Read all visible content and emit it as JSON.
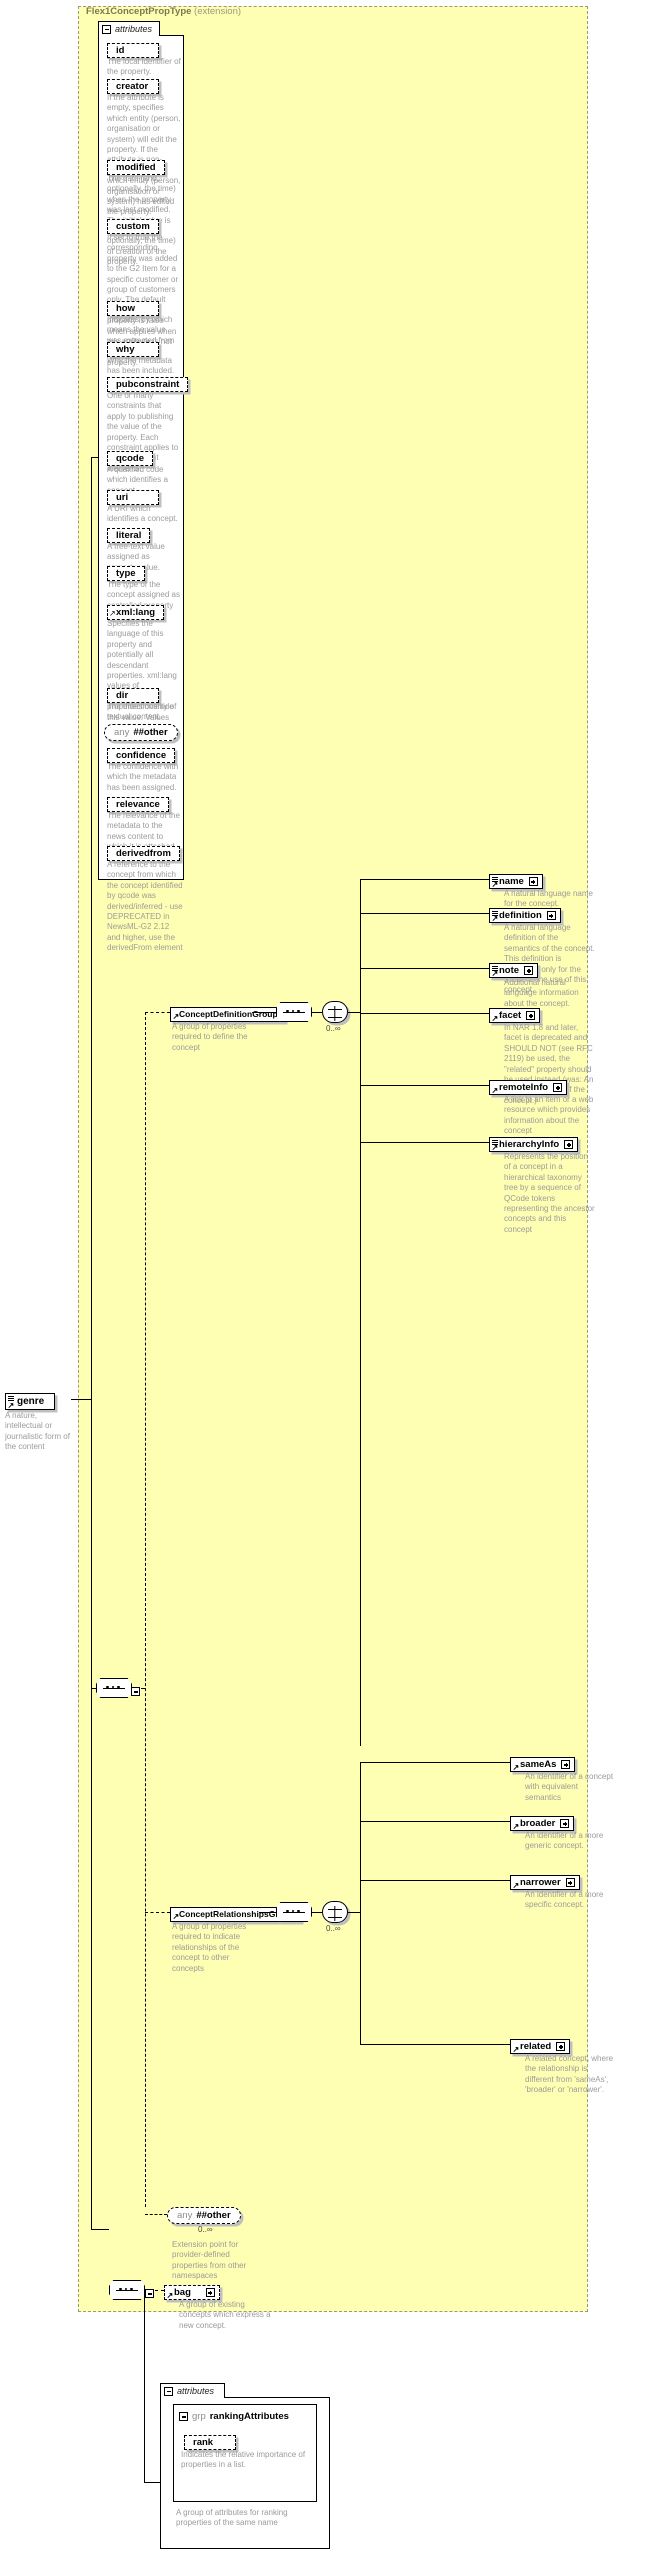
{
  "diagram": {
    "type": "xsd-schema-diagram",
    "root_element": {
      "name": "genre",
      "description": "A nature, intellectual or journalistic form of the content"
    },
    "extension_panel": {
      "title": "Flex1ConceptPropType",
      "subtitle": "(extension)"
    },
    "attributes_label": "attributes",
    "attributes": [
      {
        "name": "id",
        "description": "The local identifier of the property."
      },
      {
        "name": "creator",
        "description": "If the attribute is empty, specifies which entity (person, organisation or system) will edit the property. If the attribute is non-empty, specifies which entity (person, organisation or system) has edited the property."
      },
      {
        "name": "modified",
        "description": "The date (and, optionally, the time) when the property was last modified. The initial value is the date (and, optionally, the time) of creation of the property."
      },
      {
        "name": "custom",
        "description": "If set to true the corresponding property was added to the G2 Item for a specific customer or group of customers only. The default value of this property is false which applies when this attribute is not used with the property."
      },
      {
        "name": "how",
        "description": "Indicates by which means the value was extracted from the content."
      },
      {
        "name": "why",
        "description": "Why the metadata has been included."
      },
      {
        "name": "pubconstraint",
        "description": "One or many constraints that apply to publishing the value of the property. Each constraint applies to all descendant elements."
      },
      {
        "name": "qcode",
        "description": "A qualified code which identifies a concept."
      },
      {
        "name": "uri",
        "description": "A URI which identifies a concept."
      },
      {
        "name": "literal",
        "description": "A free-text value assigned as property value."
      },
      {
        "name": "type",
        "description": "The type of the concept assigned as controlled property value."
      },
      {
        "name": "xml:lang",
        "description": "Specifies the language of this property and potentially all descendant properties. xml:lang values of descendant properties override this value. Values are determined by Internet BCP 47."
      },
      {
        "name": "dir",
        "description": "The directionality of textual content."
      },
      {
        "name": "confidence",
        "description": "The confidence with which the metadata has been assigned."
      },
      {
        "name": "relevance",
        "description": "The relevance of the metadata to the news content to which it is attached."
      },
      {
        "name": "derivedfrom",
        "description": "A reference to the concept from which the concept identified by qcode was derived/inferred - use DEPRECATED in NewsML-G2 2.12 and higher, use the derivedFrom element"
      }
    ],
    "attribute_any": {
      "label_any": "any",
      "label_other": "##other"
    },
    "groups": [
      {
        "id": "concept-definition-group",
        "name": "ConceptDefinitionGroup",
        "description": "A group of properties required to define the concept",
        "cardinality": "0..∞",
        "elements": [
          {
            "name": "name",
            "description": "A natural language name for the concept."
          },
          {
            "name": "definition",
            "description": "A natural language definition of the semantics of the concept. This definition is normative only for the scope of the use of this concept."
          },
          {
            "name": "note",
            "description": "Additional natural language information about the concept."
          },
          {
            "name": "facet",
            "description": "In NAR 1.8 and later, facet is deprecated and SHOULD NOT (see RFC 2119) be used, the \"related\" property should be used instead (was: An intrinsic property of the concept.)"
          },
          {
            "name": "remoteInfo",
            "description": "A link to an item or a web resource which provides information about the concept"
          },
          {
            "name": "hierarchyInfo",
            "description": "Represents the position of a concept in a hierarchical taxonomy tree by a sequence of QCode tokens representing the ancestor concepts and this concept"
          }
        ]
      },
      {
        "id": "concept-relationships-group",
        "name": "ConceptRelationshipsGroup",
        "description": "A group of properties required to indicate relationships of the concept to other concepts",
        "cardinality": "0..∞",
        "elements": [
          {
            "name": "sameAs",
            "description": "An identifier of a concept with equivalent semantics"
          },
          {
            "name": "broader",
            "description": "An identifier of a more generic concept."
          },
          {
            "name": "narrower",
            "description": "An identifier of a more specific concept."
          },
          {
            "name": "related",
            "description": "A related concept, where the relationship is different from 'sameAs', 'broader' or 'narrower'."
          }
        ]
      }
    ],
    "extension_any": {
      "label_any": "any",
      "label_other": "##other",
      "cardinality": "0..∞",
      "description": "Extension point for provider-defined properties from other namespaces"
    },
    "bag": {
      "name": "bag",
      "description": "A group of existing concepts which express a new concept."
    },
    "ranking": {
      "attributes_label": "attributes",
      "grp_prefix": "grp",
      "group_name": "rankingAttributes",
      "attribute": {
        "name": "rank",
        "description": "Indicates the relative importance of properties in a list."
      },
      "group_description": "A group of attributes for ranking properties of the same name"
    },
    "colors": {
      "panel_fill": "#ffffb3",
      "panel_border": "#9a9a7a",
      "title_text": "#7a7a50",
      "description_text": "#9b9b9b",
      "node_shadow": "#bfbfbf",
      "line": "#000000"
    }
  }
}
